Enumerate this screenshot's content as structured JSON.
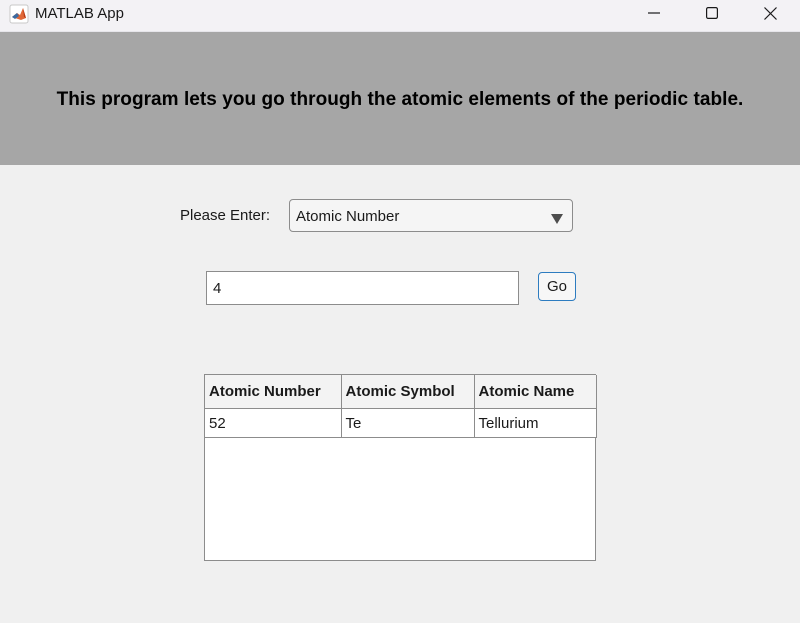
{
  "window": {
    "title": "MATLAB App",
    "icon": "matlab-logo-icon",
    "controls": [
      "minimize-icon",
      "maximize-icon",
      "close-icon"
    ]
  },
  "banner": {
    "text": "This program lets you go through the atomic elements of the periodic table."
  },
  "form": {
    "enter_label": "Please Enter:",
    "dropdown_value": "Atomic Number",
    "input_value": "4",
    "go_label": "Go"
  },
  "table": {
    "headers": [
      "Atomic Number",
      "Atomic Symbol",
      "Atomic Name"
    ],
    "rows": [
      [
        "52",
        "Te",
        "Tellurium"
      ]
    ]
  },
  "colors": {
    "banner_bg": "#a6a6a6",
    "window_bg": "#f0f0f0",
    "button_border": "#2d7cc0"
  }
}
